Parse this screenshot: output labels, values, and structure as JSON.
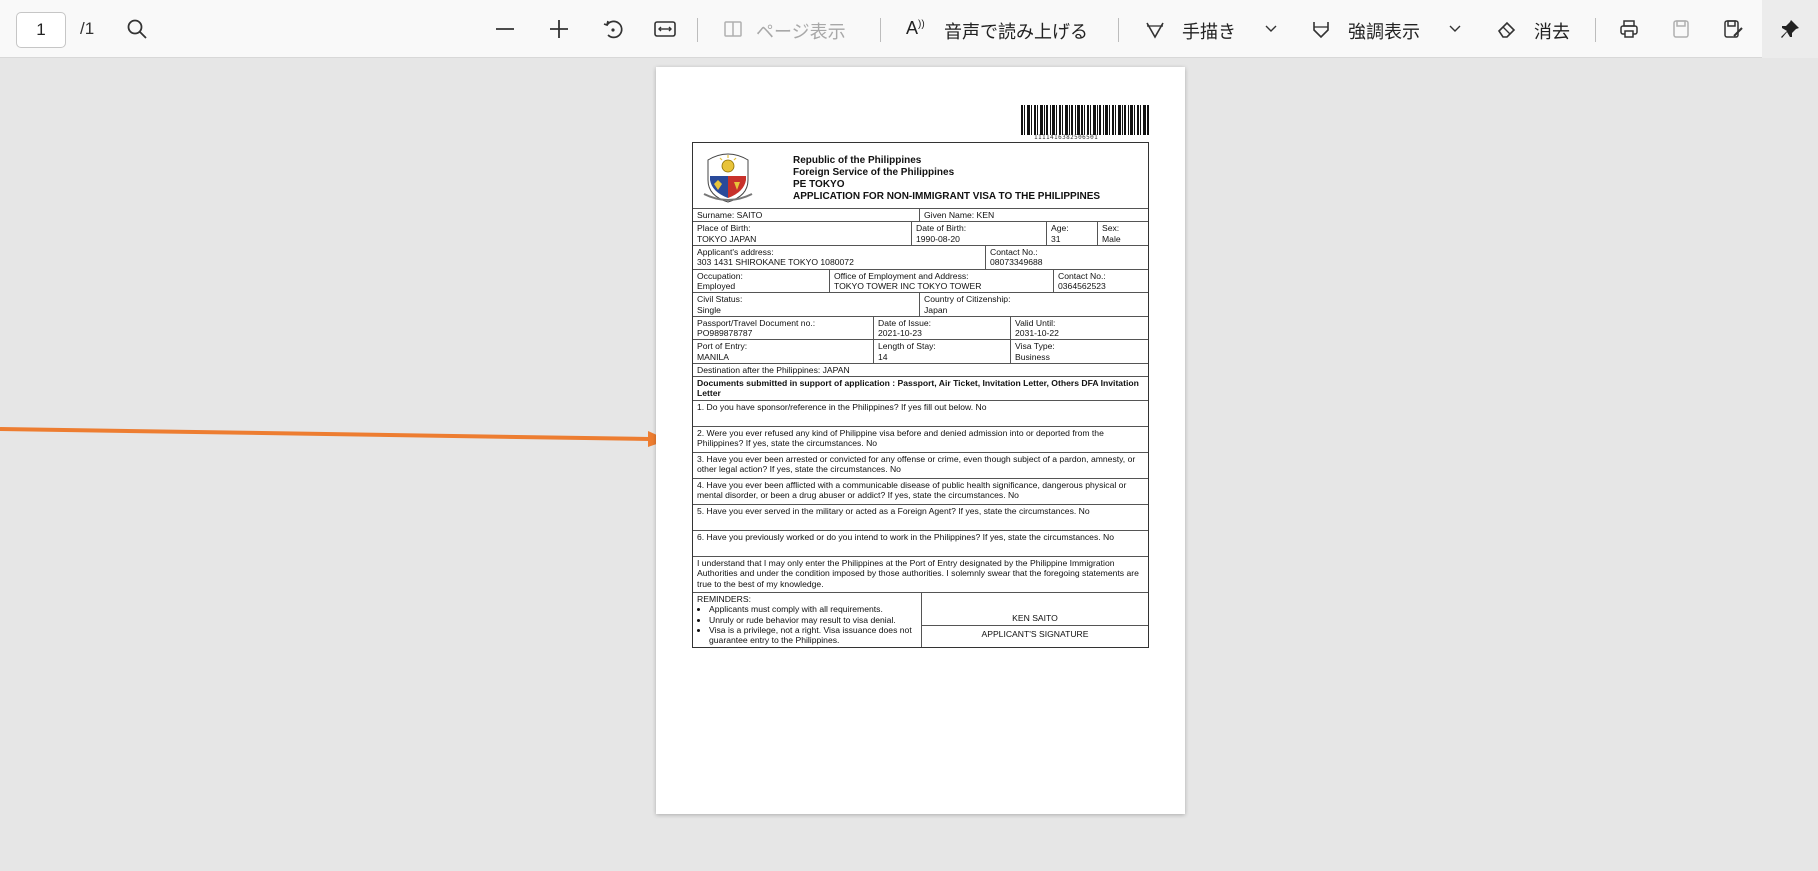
{
  "toolbar": {
    "page_current": "1",
    "page_total": "/1",
    "page_view_label": "ページ表示",
    "read_aloud_label": "音声で読み上げる",
    "draw_label": "手描き",
    "highlight_label": "強調表示",
    "erase_label": "消去"
  },
  "document": {
    "barcode_number": "1111416382506501",
    "header": {
      "line1": "Republic of the Philippines",
      "line2": "Foreign Service of the Philippines",
      "line3": "PE TOKYO",
      "line4": "APPLICATION FOR NON-IMMIGRANT VISA TO THE PHILIPPINES"
    },
    "surname": "Surname: SAITO",
    "given_name": "Given Name: KEN",
    "place_of_birth": {
      "label": "Place of Birth:",
      "value": "TOKYO JAPAN"
    },
    "date_of_birth": {
      "label": "Date of Birth:",
      "value": "1990-08-20"
    },
    "age": {
      "label": "Age:",
      "value": "31"
    },
    "sex": {
      "label": "Sex:",
      "value": "Male"
    },
    "address": {
      "label": "Applicant's address:",
      "value": "303 1431 SHIROKANE TOKYO 1080072"
    },
    "contact": {
      "label": "Contact No.:",
      "value": "08073349688"
    },
    "occupation": {
      "label": "Occupation:",
      "value": "Employed"
    },
    "office": {
      "label": "Office of Employment and Address:",
      "value": "TOKYO TOWER INC TOKYO TOWER"
    },
    "office_contact": {
      "label": "Contact No.:",
      "value": "0364562523"
    },
    "civil_status": {
      "label": "Civil Status:",
      "value": "Single"
    },
    "citizenship": {
      "label": "Country of Citizenship:",
      "value": "Japan"
    },
    "passport": {
      "label": "Passport/Travel Document no.:",
      "value": "PO989878787"
    },
    "date_of_issue": {
      "label": "Date of Issue:",
      "value": "2021-10-23"
    },
    "valid_until": {
      "label": "Valid Until:",
      "value": "2031-10-22"
    },
    "port_of_entry": {
      "label": "Port of Entry:",
      "value": "MANILA"
    },
    "length_of_stay": {
      "label": "Length of Stay:",
      "value": "14"
    },
    "visa_type": {
      "label": "Visa Type:",
      "value": "Business"
    },
    "destination": "Destination after the Philippines: JAPAN",
    "documents": "Documents submitted in support of application : Passport, Air Ticket, Invitation Letter, Others DFA Invitation Letter",
    "questions": [
      "1. Do you have sponsor/reference in the Philippines? If yes fill out below. No",
      "2. Were you ever refused any kind of Philippine visa before and denied admission into or deported from the Philippines? If yes, state the circumstances. No",
      "3. Have you ever been arrested or convicted for any offense or crime, even though subject of a pardon, amnesty, or other legal action? If yes, state the circumstances. No",
      "4. Have you ever been afflicted with a communicable disease of public health significance, dangerous physical or mental disorder, or been a drug abuser or addict? If yes, state the circumstances. No",
      "5. Have you ever served in the military or acted as a Foreign Agent? If yes, state the circumstances. No",
      "6. Have you previously worked or do you intend to work in the Philippines? If yes, state the circumstances. No"
    ],
    "declaration": "I understand that I may only enter the Philippines at the Port of Entry designated by the Philippine Immigration Authorities and under the condition imposed by those authorities. I solemnly swear that the foregoing statements are true to the best of my knowledge.",
    "reminders": {
      "title": "REMINDERS:",
      "items": [
        "Applicants must comply with all requirements.",
        "Unruly or rude behavior may result to visa denial.",
        "Visa is a privilege, not a right. Visa issuance does not guarantee entry to the Philippines."
      ]
    },
    "signature_name": "KEN SAITO",
    "signature_label": "APPLICANT'S SIGNATURE"
  },
  "colors": {
    "arrow": "#ed7d31",
    "toolbar_bg": "#f9f9f9",
    "viewer_bg": "#e6e6e6"
  }
}
